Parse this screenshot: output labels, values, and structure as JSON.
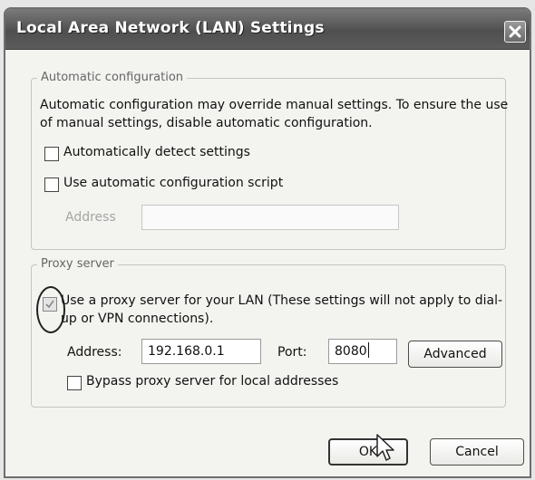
{
  "window": {
    "title": "Local Area Network (LAN) Settings"
  },
  "automatic_configuration": {
    "legend": "Automatic configuration",
    "description": "Automatic configuration may override manual settings.  To ensure the use of manual settings, disable automatic configuration.",
    "detect_settings": {
      "label": "Automatically detect settings",
      "checked": false
    },
    "config_script": {
      "label": "Use automatic configuration script",
      "checked": false
    },
    "address": {
      "label": "Address",
      "value": "",
      "enabled": false
    }
  },
  "proxy_server": {
    "legend": "Proxy server",
    "use_proxy": {
      "label": "Use a proxy server for your LAN (These settings will not apply to dial-up or VPN connections).",
      "checked": true
    },
    "address": {
      "label": "Address:",
      "value": "192.168.0.1"
    },
    "port": {
      "label": "Port:",
      "value": "8080"
    },
    "advanced_label": "Advanced",
    "bypass_local": {
      "label": "Bypass proxy server for local addresses",
      "checked": false
    }
  },
  "buttons": {
    "ok_label": "OK",
    "cancel_label": "Cancel"
  },
  "icons": {
    "close": "close-icon",
    "checkmark": "checkmark-icon",
    "pointer": "mouse-pointer-icon"
  }
}
